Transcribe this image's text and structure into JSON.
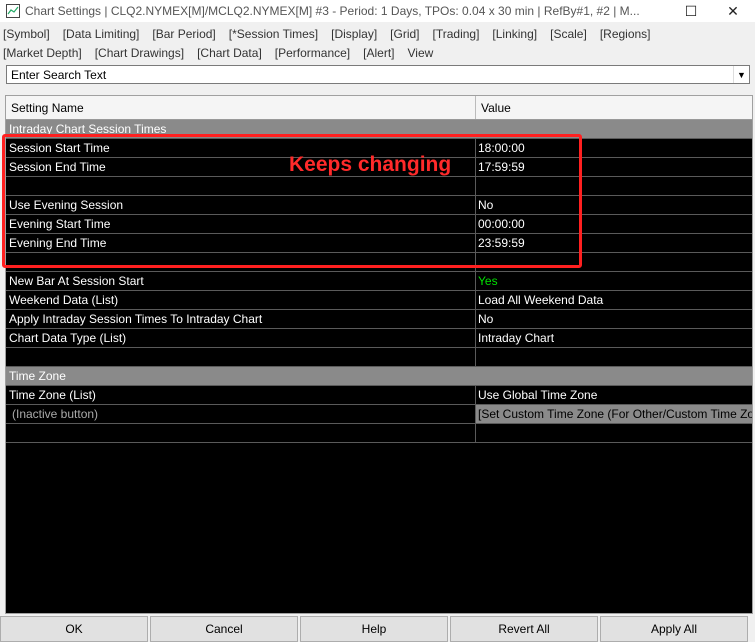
{
  "window": {
    "title": "Chart Settings | CLQ2.NYMEX[M]/MCLQ2.NYMEX[M]  #3 - Period: 1 Days, TPOs: 0.04 x 30 min   | RefBy#1, #2 | M...",
    "close_symbol": "✕",
    "maximize_symbol": "☐"
  },
  "tabs": {
    "row1": [
      "[Symbol]",
      "[Data Limiting]",
      "[Bar Period]",
      "[*Session Times]",
      "[Display]",
      "[Grid]",
      "[Trading]",
      "[Linking]",
      "[Scale]",
      "[Regions]"
    ],
    "row2": [
      "[Market Depth]",
      "[Chart Drawings]",
      "[Chart Data]",
      "[Performance]",
      "[Alert]",
      "View"
    ]
  },
  "search": {
    "value": "Enter Search Text"
  },
  "grid": {
    "headers": {
      "name": "Setting Name",
      "value": "Value"
    },
    "section1": "Intraday Chart Session Times",
    "rows1": [
      {
        "name": "Session Start Time",
        "value": "18:00:00"
      },
      {
        "name": "Session End Time",
        "value": "17:59:59"
      },
      {
        "name": "",
        "value": ""
      },
      {
        "name": "Use Evening Session",
        "value": "No"
      },
      {
        "name": "Evening Start Time",
        "value": "00:00:00"
      },
      {
        "name": "Evening End Time",
        "value": "23:59:59"
      },
      {
        "name": "",
        "value": ""
      },
      {
        "name": "New Bar At Session Start",
        "value": "Yes"
      },
      {
        "name": "Weekend Data (List)",
        "value": "Load All Weekend Data"
      },
      {
        "name": "Apply Intraday Session Times To Intraday Chart",
        "value": "No"
      },
      {
        "name": "Chart Data Type (List)",
        "value": "Intraday Chart"
      },
      {
        "name": "",
        "value": ""
      }
    ],
    "section2": "Time Zone",
    "rows2": [
      {
        "name": "Time Zone (List)",
        "value": "Use Global Time Zone"
      },
      {
        "name": "(Inactive button)",
        "value": "[Set Custom Time Zone (For Other/Custom Time Zone)]"
      },
      {
        "name": "",
        "value": ""
      }
    ]
  },
  "annotation": {
    "text": "Keeps changing",
    "color": "#ff2020"
  },
  "colors": {
    "yes_value": "#00e000",
    "grid_bg": "#000000",
    "section_bg": "#8a8a8a"
  },
  "buttons": [
    "OK",
    "Cancel",
    "Help",
    "Revert All",
    "Apply All"
  ]
}
